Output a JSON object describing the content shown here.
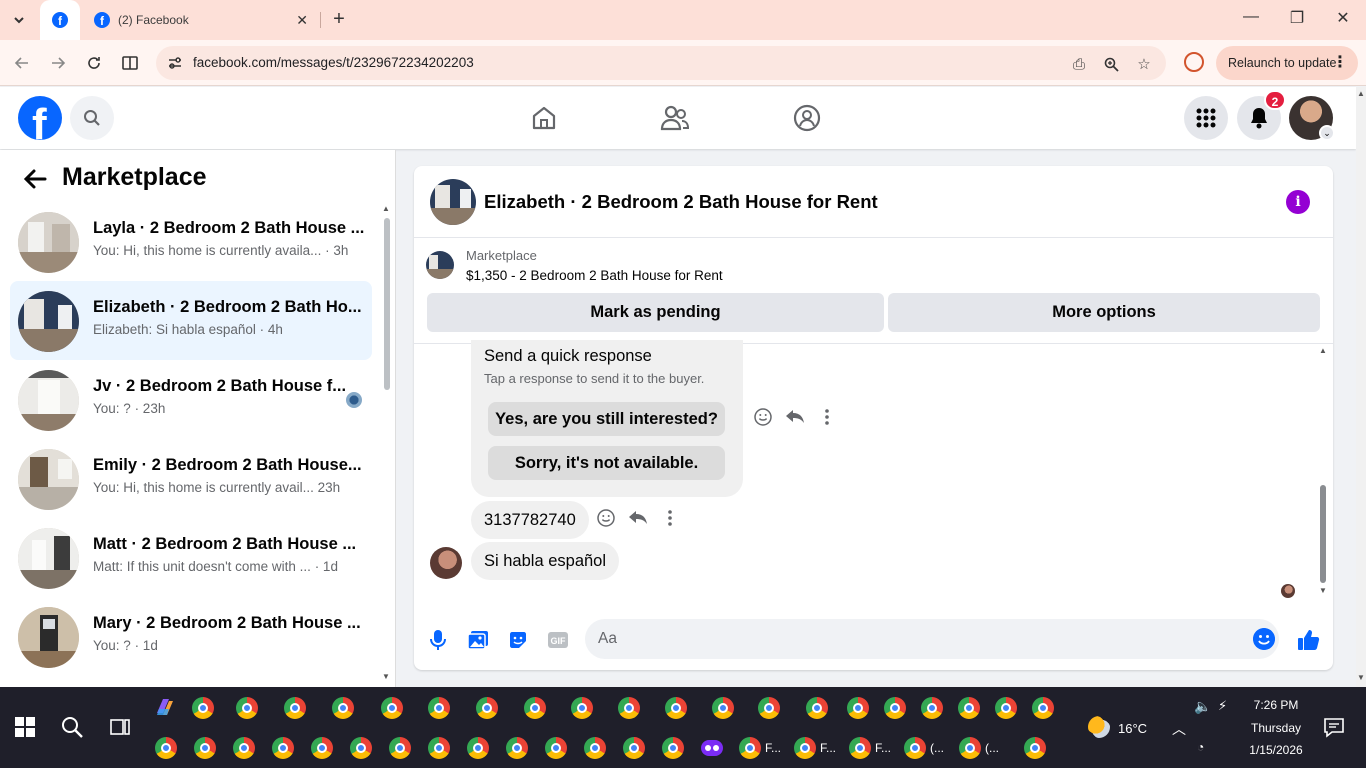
{
  "browser": {
    "tab_title": "(2) Facebook",
    "url": "facebook.com/messages/t/2329672234202203",
    "relaunch_label": "Relaunch to update"
  },
  "header": {
    "notification_count": "2"
  },
  "left_panel": {
    "title": "Marketplace",
    "conversations": [
      {
        "name": "Layla · 2 Bedroom 2 Bath House ...",
        "preview": "You: Hi, this home is currently availa...",
        "time": "· 3h"
      },
      {
        "name": "Elizabeth · 2 Bedroom 2 Bath Ho...",
        "preview": "Elizabeth: Si habla español",
        "time": "· 4h",
        "selected": true
      },
      {
        "name": "Jv · 2 Bedroom 2 Bath House f...",
        "preview": "You: ?",
        "time": "· 23h"
      },
      {
        "name": "Emily · 2 Bedroom 2 Bath House...",
        "preview": "You: Hi, this home is currently avail...",
        "time": "23h"
      },
      {
        "name": "Matt · 2 Bedroom 2 Bath House ...",
        "preview": "Matt: If this unit doesn't come with ...",
        "time": "· 1d"
      },
      {
        "name": "Mary · 2 Bedroom 2 Bath House ...",
        "preview": "You: ?",
        "time": "· 1d"
      }
    ]
  },
  "chat": {
    "title": "Elizabeth · 2 Bedroom 2 Bath House for Rent",
    "listing_label": "Marketplace",
    "listing_title": "$1,350 - 2 Bedroom 2 Bath House for Rent",
    "mark_pending_label": "Mark as pending",
    "more_options_label": "More options",
    "quick_response": {
      "title": "Send a quick response",
      "subtitle": "Tap a response to send it to the buyer.",
      "options": [
        "Yes, are you still interested?",
        "Sorry, it's not available."
      ]
    },
    "messages": [
      {
        "sender": "me",
        "text": "3137782740"
      },
      {
        "sender": "them",
        "text": "Si habla español"
      }
    ],
    "composer_placeholder": "Aa"
  },
  "taskbar": {
    "weather": "16°C",
    "time": "7:26 PM",
    "day": "Thursday",
    "date": "1/15/2026",
    "window_labels": [
      "F...",
      "F...",
      "F...",
      "(...",
      "(..."
    ]
  },
  "colors": {
    "facebook_blue": "#0866ff",
    "info_purple": "#9400d3",
    "selected_bg": "#ebf5ff",
    "badge_red": "#e41e3f"
  }
}
